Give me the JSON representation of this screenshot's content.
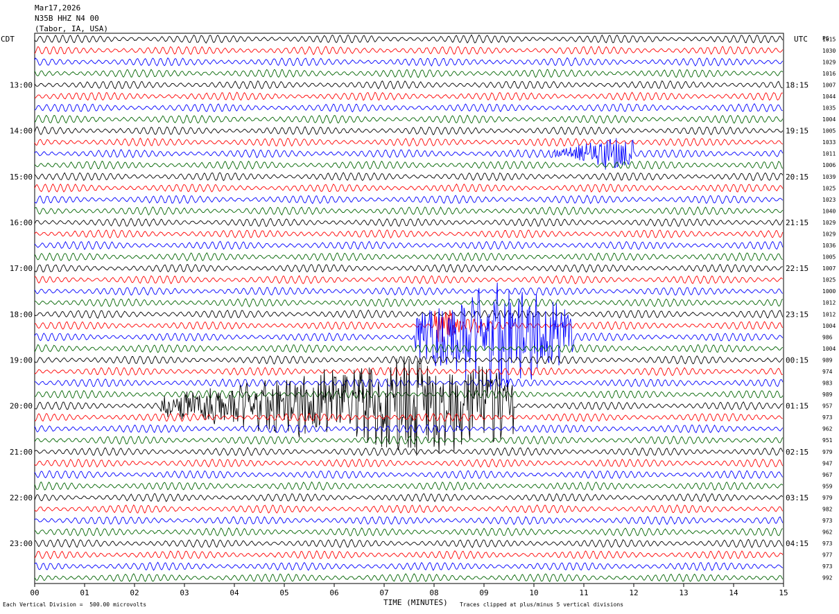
{
  "header": {
    "date": "Mar17,2026",
    "station": "N35B HHZ N4 00",
    "location": "(Tabor, IA, USA)"
  },
  "left_label": "CDT",
  "right_label": "UTC",
  "pg_label": "PG",
  "footer": {
    "scale": "Each Vertical Division =  500.00 microvolts",
    "xaxis_title": "TIME (MINUTES)",
    "clip_note": "Traces clipped at plus/minus 5 vertical divisions"
  },
  "colors": {
    "trace_cycle": [
      "#000000",
      "#ff0000",
      "#0000ff",
      "#006400"
    ],
    "grid": "#000000",
    "background": "#ffffff"
  },
  "chart_data": {
    "type": "line",
    "title": "Mar17,2026",
    "subtitle": "N35B HHZ N4 00 (Tabor, IA, USA)",
    "xlabel": "TIME (MINUTES)",
    "xlim": [
      0,
      15
    ],
    "x_ticks": [
      "00",
      "01",
      "02",
      "03",
      "04",
      "05",
      "06",
      "07",
      "08",
      "09",
      "10",
      "11",
      "12",
      "13",
      "14",
      "15"
    ],
    "rows_per_hour": 4,
    "row_minutes": 15,
    "left_time_labels": [
      {
        "row": 4,
        "label": "13:00"
      },
      {
        "row": 8,
        "label": "14:00"
      },
      {
        "row": 12,
        "label": "15:00"
      },
      {
        "row": 16,
        "label": "16:00"
      },
      {
        "row": 20,
        "label": "17:00"
      },
      {
        "row": 24,
        "label": "18:00"
      },
      {
        "row": 28,
        "label": "19:00"
      },
      {
        "row": 32,
        "label": "20:00"
      },
      {
        "row": 36,
        "label": "21:00"
      },
      {
        "row": 40,
        "label": "22:00"
      },
      {
        "row": 44,
        "label": "23:00"
      }
    ],
    "right_time_labels": [
      {
        "row": 4,
        "label": "18:15"
      },
      {
        "row": 8,
        "label": "19:15"
      },
      {
        "row": 12,
        "label": "20:15"
      },
      {
        "row": 16,
        "label": "21:15"
      },
      {
        "row": 20,
        "label": "22:15"
      },
      {
        "row": 24,
        "label": "23:15"
      },
      {
        "row": 28,
        "label": "00:15"
      },
      {
        "row": 32,
        "label": "01:15"
      },
      {
        "row": 36,
        "label": "02:15"
      },
      {
        "row": 40,
        "label": "03:15"
      },
      {
        "row": 44,
        "label": "04:15"
      }
    ],
    "row_pg_values": [
      "1015",
      "1030",
      "1029",
      "1016",
      "1007",
      "1044",
      "1035",
      "1004",
      "1005",
      "1033",
      "1011",
      "1006",
      "1039",
      "1025",
      "1023",
      "1040",
      "1029",
      "1029",
      "1036",
      "1005",
      "1007",
      "1025",
      "1000",
      "1012",
      "1012",
      "1004",
      "986",
      "1004",
      "989",
      "974",
      "983",
      "989",
      "957",
      "973",
      "962",
      "951",
      "979",
      "947",
      "967",
      "959",
      "979",
      "982",
      "973",
      "962",
      "973",
      "977",
      "973",
      "992"
    ],
    "events": [
      {
        "row": 10,
        "start_min": 10.3,
        "end_min": 12.0,
        "peak_min": 11.5,
        "amplitude": 1.2
      },
      {
        "row": 25,
        "start_min": 8.0,
        "end_min": 9.0,
        "peak_min": 8.0,
        "amplitude": 1.5
      },
      {
        "row": 26,
        "start_min": 7.6,
        "end_min": 10.8,
        "peak_min": 9.3,
        "amplitude": 4.0
      },
      {
        "row": 32,
        "start_min": 2.5,
        "end_min": 9.6,
        "peak_min": 7.7,
        "amplitude": 3.5
      }
    ]
  }
}
